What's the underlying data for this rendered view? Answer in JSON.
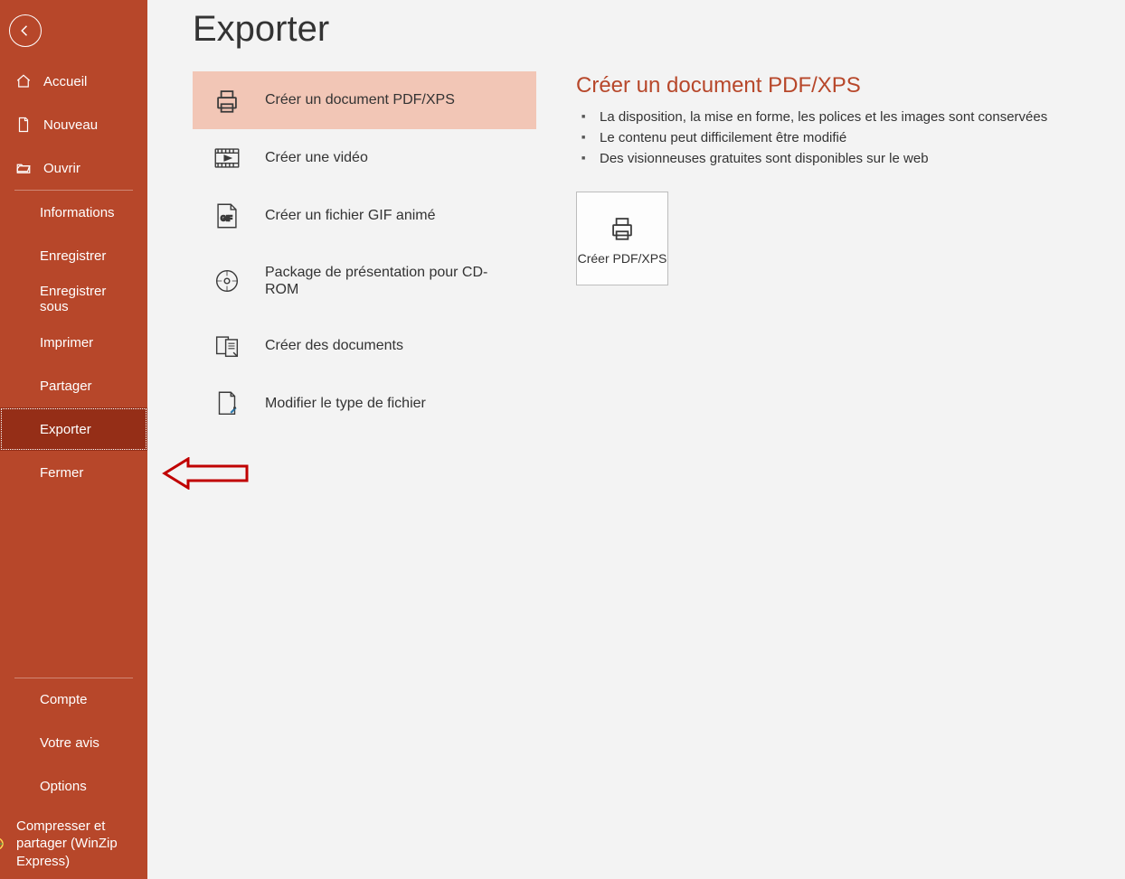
{
  "page": {
    "title": "Exporter"
  },
  "sidebar": {
    "top": [
      {
        "label": "Accueil"
      },
      {
        "label": "Nouveau"
      },
      {
        "label": "Ouvrir"
      }
    ],
    "middle": [
      {
        "label": "Informations"
      },
      {
        "label": "Enregistrer"
      },
      {
        "label": "Enregistrer sous"
      },
      {
        "label": "Imprimer"
      },
      {
        "label": "Partager"
      },
      {
        "label": "Exporter"
      },
      {
        "label": "Fermer"
      }
    ],
    "bottom": [
      {
        "label": "Compte"
      },
      {
        "label": "Votre avis"
      },
      {
        "label": "Options"
      },
      {
        "label": "Compresser et partager (WinZip Express)"
      }
    ]
  },
  "exportOptions": [
    {
      "label": "Créer un document PDF/XPS"
    },
    {
      "label": "Créer une vidéo"
    },
    {
      "label": "Créer un fichier GIF animé"
    },
    {
      "label": "Package de présentation pour CD-ROM"
    },
    {
      "label": "Créer des documents"
    },
    {
      "label": "Modifier le type de fichier"
    }
  ],
  "detail": {
    "title": "Créer un document PDF/XPS",
    "bullets": [
      "La disposition, la mise en forme, les polices et les images sont conservées",
      "Le contenu peut difficilement être modifié",
      "Des visionneuses gratuites sont disponibles sur le web"
    ],
    "button": "Créer PDF/XPS"
  }
}
